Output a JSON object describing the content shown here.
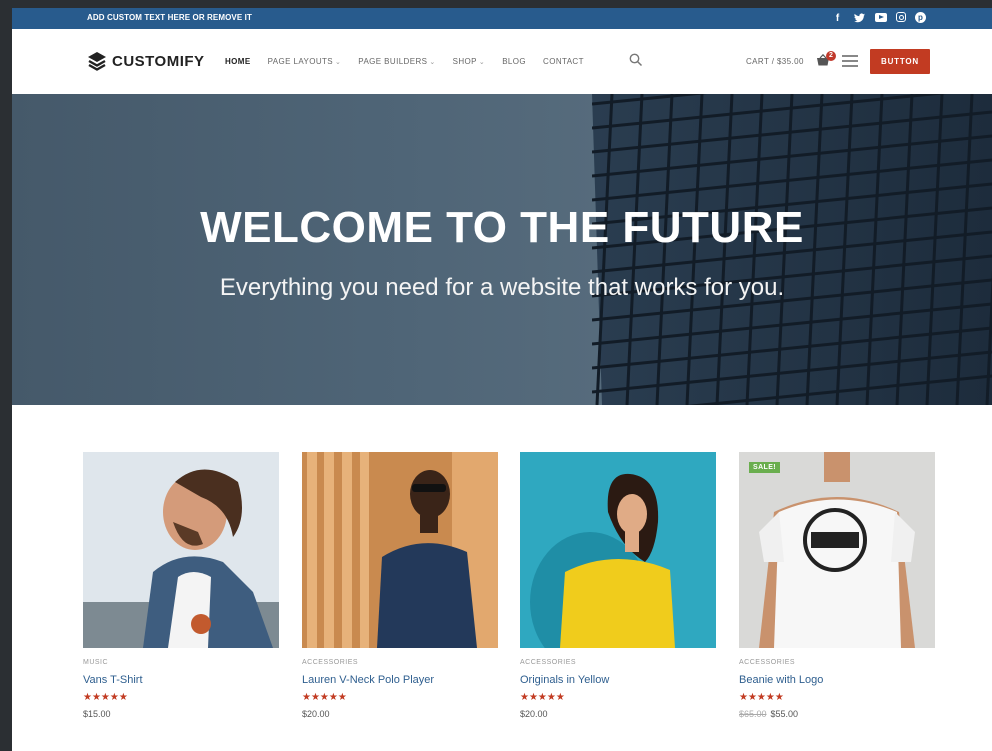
{
  "topbar": {
    "message": "ADD CUSTOM TEXT HERE OR REMOVE IT",
    "socials": [
      "facebook-icon",
      "twitter-icon",
      "youtube-icon",
      "instagram-icon",
      "pinterest-icon"
    ]
  },
  "header": {
    "logo_text": "CUSTOMIFY",
    "nav": [
      {
        "label": "HOME",
        "active": true,
        "dropdown": false
      },
      {
        "label": "PAGE LAYOUTS",
        "active": false,
        "dropdown": true
      },
      {
        "label": "PAGE BUILDERS",
        "active": false,
        "dropdown": true
      },
      {
        "label": "SHOP",
        "active": false,
        "dropdown": true
      },
      {
        "label": "BLOG",
        "active": false,
        "dropdown": false
      },
      {
        "label": "CONTACT",
        "active": false,
        "dropdown": false
      }
    ],
    "cart_label": "CART / $35.00",
    "cart_count": "2",
    "button_label": "BUTTON"
  },
  "hero": {
    "title": "WELCOME TO THE FUTURE",
    "subtitle": "Everything you need for a website that works for you."
  },
  "products": [
    {
      "category": "MUSIC",
      "name": "Vans T-Shirt",
      "stars": "★★★★★",
      "price": "$15.00",
      "old_price": "",
      "sale_badge": ""
    },
    {
      "category": "ACCESSORIES",
      "name": "Lauren V-Neck Polo Player",
      "stars": "★★★★★",
      "price": "$20.00",
      "old_price": "",
      "sale_badge": ""
    },
    {
      "category": "ACCESSORIES",
      "name": "Originals in Yellow",
      "stars": "★★★★★",
      "price": "$20.00",
      "old_price": "",
      "sale_badge": ""
    },
    {
      "category": "ACCESSORIES",
      "name": "Beanie with Logo",
      "stars": "★★★★★",
      "price": "$55.00",
      "old_price": "$65.00",
      "sale_badge": "SALE!"
    }
  ],
  "colors": {
    "topbar": "#285b8d",
    "accent_button": "#c23b22",
    "link": "#2f5f8f",
    "sale_badge": "#6aae4e"
  }
}
